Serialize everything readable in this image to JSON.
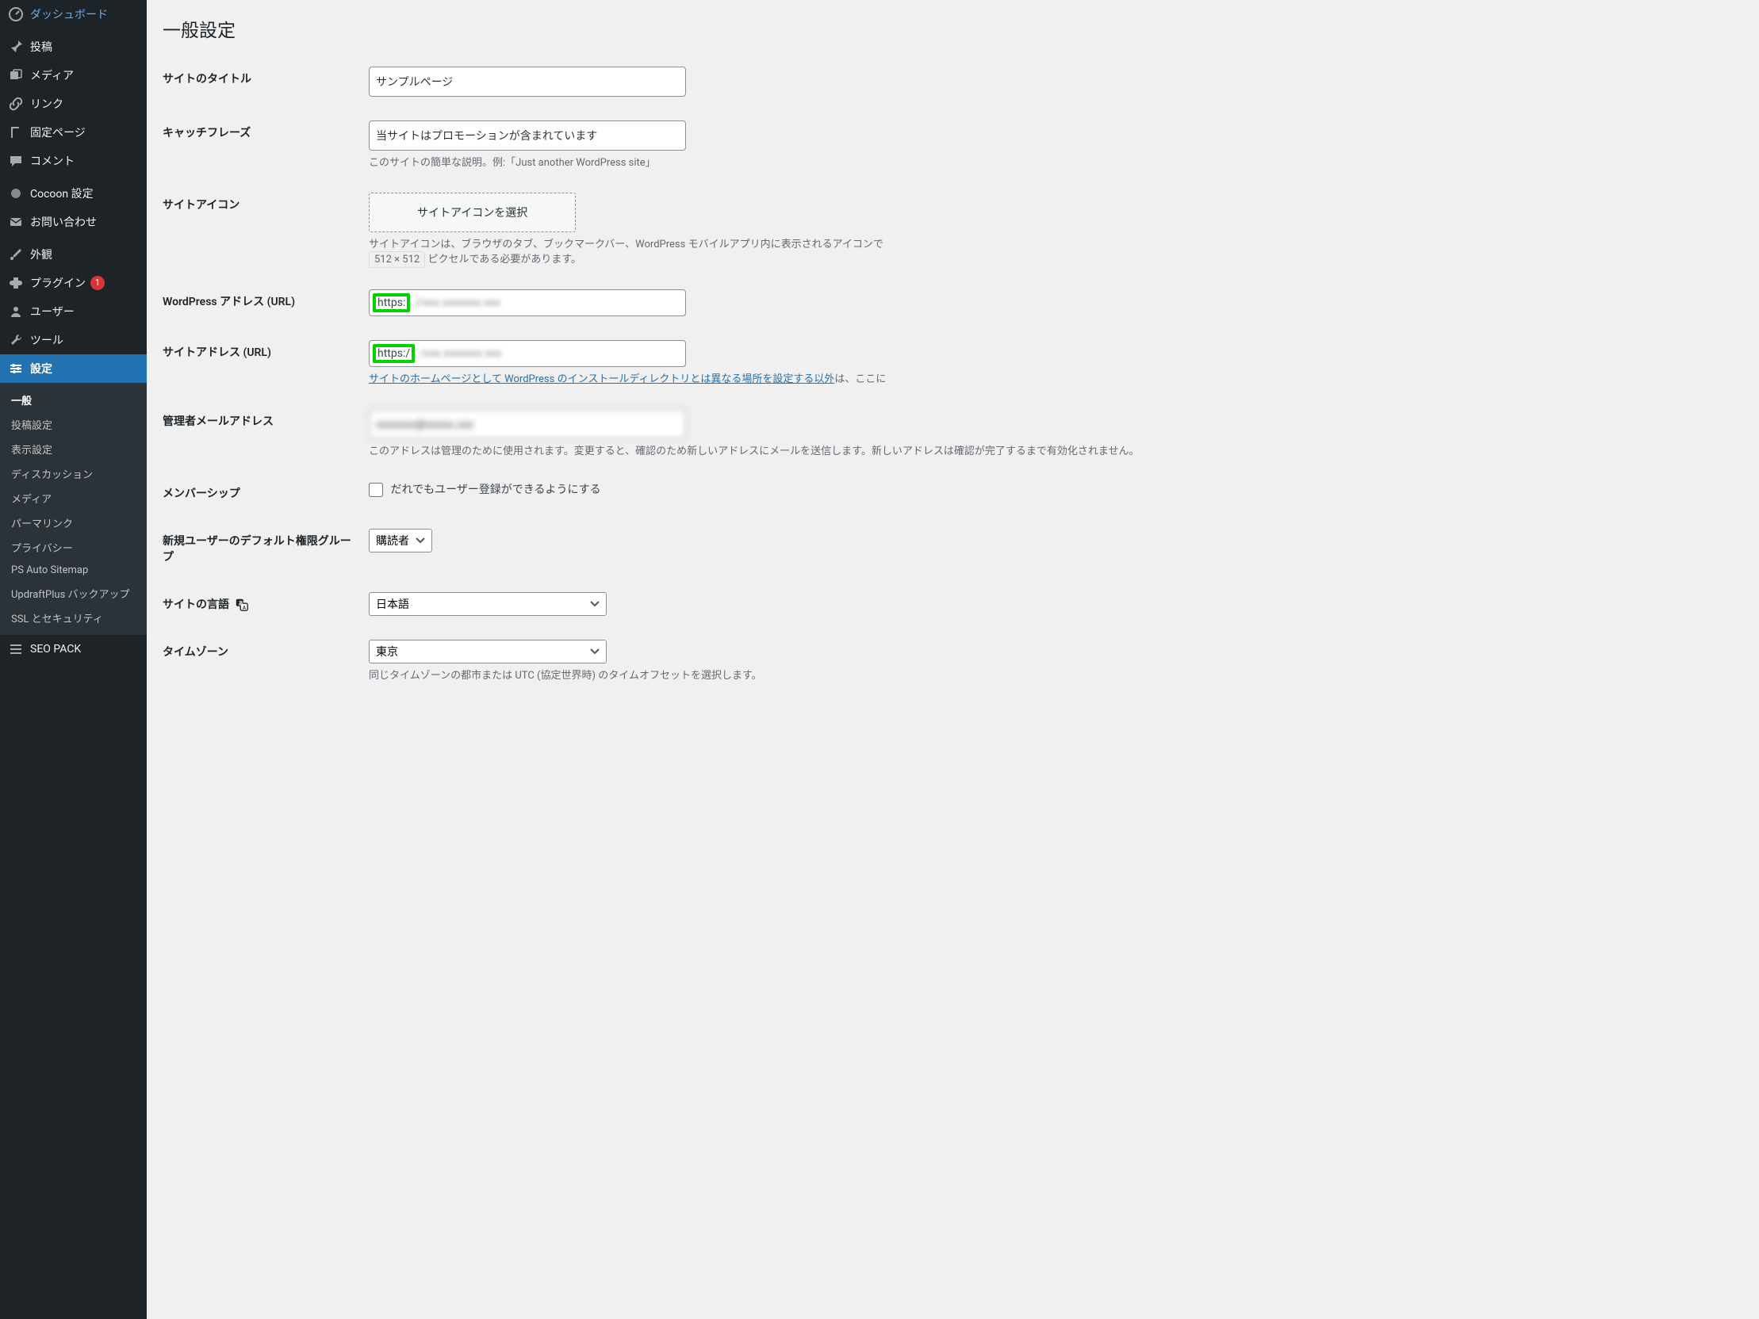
{
  "sidebar": {
    "dashboard": "ダッシュボード",
    "posts": "投稿",
    "media": "メディア",
    "links": "リンク",
    "pages": "固定ページ",
    "comments": "コメント",
    "cocoon": "Cocoon 設定",
    "contact": "お問い合わせ",
    "appearance": "外観",
    "plugins": "プラグイン",
    "plugins_badge": "1",
    "users": "ユーザー",
    "tools": "ツール",
    "settings": "設定",
    "seopack": "SEO PACK",
    "submenu": {
      "general": "一般",
      "writing": "投稿設定",
      "reading": "表示設定",
      "discussion": "ディスカッション",
      "media": "メディア",
      "permalinks": "パーマリンク",
      "privacy": "プライバシー",
      "ps_sitemap": "PS Auto Sitemap",
      "updraft": "UpdraftPlus バックアップ",
      "ssl": "SSL とセキュリティ"
    }
  },
  "page": {
    "title": "一般設定",
    "fields": {
      "site_title_label": "サイトのタイトル",
      "site_title_value": "サンプルページ",
      "tagline_label": "キャッチフレーズ",
      "tagline_value": "当サイトはプロモーションが含まれています",
      "tagline_desc": "このサイトの簡単な説明。例:「Just another WordPress site」",
      "site_icon_label": "サイトアイコン",
      "site_icon_button": "サイトアイコンを選択",
      "site_icon_desc1": "サイトアイコンは、ブラウザのタブ、ブックマークバー、WordPress モバイルアプリ内に表示されるアイコンで",
      "site_icon_pill": "512 × 512",
      "site_icon_desc2": "ピクセルである必要があります。",
      "wpurl_label": "WordPress アドレス (URL)",
      "wpurl_prefix": "https:",
      "siteurl_label": "サイトアドレス (URL)",
      "siteurl_prefix": "https:/",
      "siteurl_desc_link": "サイトのホームページとして WordPress のインストールディレクトリとは異なる場所を設定する以外",
      "siteurl_desc_tail": "は、ここに",
      "admin_email_label": "管理者メールアドレス",
      "admin_email_desc": "このアドレスは管理のために使用されます。変更すると、確認のため新しいアドレスにメールを送信します。新しいアドレスは確認が完了するまで有効化されません。",
      "membership_label": "メンバーシップ",
      "membership_check": "だれでもユーザー登録ができるようにする",
      "default_role_label": "新規ユーザーのデフォルト権限グループ",
      "default_role_value": "購読者",
      "language_label": "サイトの言語",
      "language_value": "日本語",
      "timezone_label": "タイムゾーン",
      "timezone_value": "東京",
      "timezone_desc": "同じタイムゾーンの都市または UTC (協定世界時) のタイムオフセットを選択します。"
    }
  }
}
